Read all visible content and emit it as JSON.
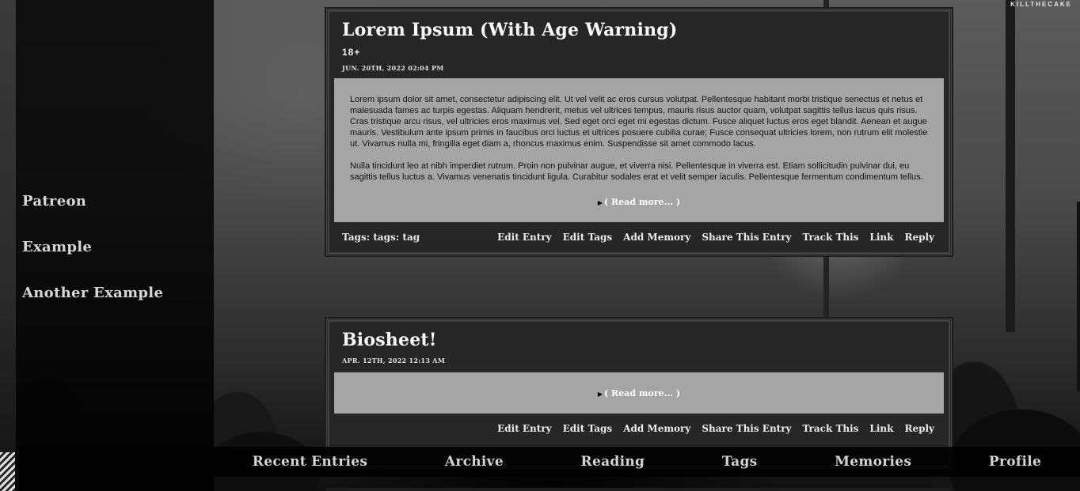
{
  "site": {
    "corner_label": "KILLTHECAKE"
  },
  "sidebar": {
    "links": [
      {
        "label": "Patreon"
      },
      {
        "label": "Example"
      },
      {
        "label": "Another Example"
      }
    ]
  },
  "entries": [
    {
      "title": "Lorem Ipsum (With Age Warning)",
      "age_warning": "18+",
      "date": "JUN. 20TH, 2022 02:04 PM",
      "paragraphs": [
        "Lorem ipsum dolor sit amet, consectetur adipiscing elit. Ut vel velit ac eros cursus volutpat. Pellentesque habitant morbi tristique senectus et netus et malesuada fames ac turpis egestas. Aliquam hendrerit, metus vel ultrices tempus, mauris risus auctor quam, volutpat sagittis tellus lacus quis risus. Cras tristique arcu risus, vel ultricies eros maximus vel. Sed eget orci eget mi egestas dictum. Fusce aliquet luctus eros eget blandit. Aenean et augue mauris. Vestibulum ante ipsum primis in faucibus orci luctus et ultrices posuere cubilia curae; Fusce consequat ultricies lorem, non rutrum elit molestie ut. Vivamus nulla mi, fringilla eget diam a, rhoncus maximus enim. Suspendisse sit amet commodo lacus.",
        "Nulla tincidunt leo at nibh imperdiet rutrum. Proin non pulvinar augue, et viverra nisi. Pellentesque in viverra est. Etiam sollicitudin pulvinar dui, eu sagittis tellus luctus a. Vivamus venenatis tincidunt ligula. Curabitur sodales erat et velit semper iaculis. Pellentesque fermentum condimentum tellus."
      ],
      "read_more": "( Read more... )",
      "tags_label": "Tags:",
      "tags": "tags: tag",
      "actions": [
        "Edit Entry",
        "Edit Tags",
        "Add Memory",
        "Share This Entry",
        "Track This",
        "Link",
        "Reply"
      ]
    },
    {
      "title": "Biosheet!",
      "date": "APR. 12TH, 2022 12:13 AM",
      "read_more": "( Read more... )",
      "actions": [
        "Edit Entry",
        "Edit Tags",
        "Add Memory",
        "Share This Entry",
        "Track This",
        "Link",
        "Reply"
      ]
    }
  ],
  "bottom_nav": {
    "items": [
      "Recent Entries",
      "Archive",
      "Reading",
      "Tags",
      "Memories",
      "Profile"
    ]
  }
}
